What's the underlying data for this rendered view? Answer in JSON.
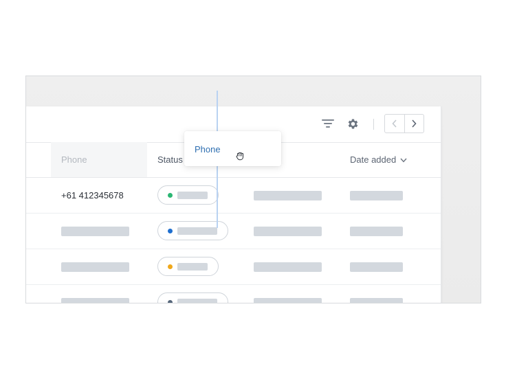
{
  "toolbar": {
    "filter_icon": "filter-icon",
    "settings_icon": "gear-icon",
    "prev_icon": "chevron-left-icon",
    "next_icon": "chevron-right-icon"
  },
  "table": {
    "columns": [
      {
        "key": "phone",
        "label": "Phone"
      },
      {
        "key": "status",
        "label": "Status"
      },
      {
        "key": "date_added",
        "label": "Date added",
        "sort_icon": "chevron-down-icon"
      }
    ],
    "rows": [
      {
        "phone": "+61 412345678",
        "status_color": "#2bb673"
      },
      {
        "phone": "",
        "status_color": "#1f6fcf"
      },
      {
        "phone": "",
        "status_color": "#f0a81b"
      },
      {
        "phone": "",
        "status_color": "#55667a"
      }
    ]
  },
  "drag_ghost": {
    "label": "Phone",
    "cursor_icon": "grab-hand-icon"
  },
  "colors": {
    "accent": "#2f6fb1",
    "drop_indicator": "#b9d2f2",
    "skeleton": "#d3d8de"
  }
}
